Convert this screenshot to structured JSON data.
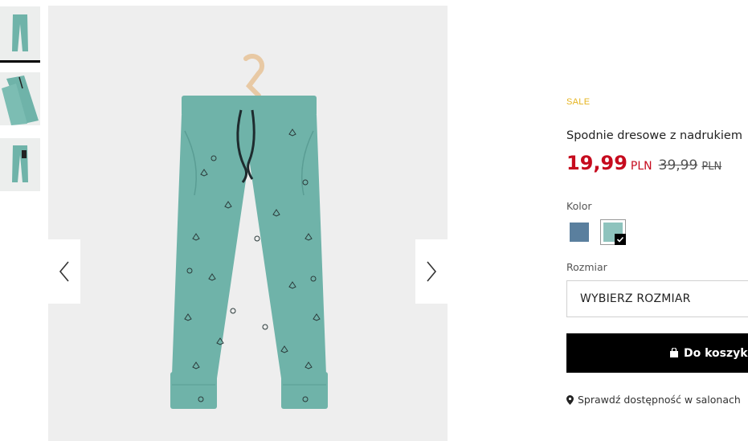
{
  "gallery": {
    "thumbnails": [
      "front",
      "detail",
      "back"
    ],
    "active_index": 0
  },
  "product": {
    "badge": "SALE",
    "title": "Spodnie dresowe z nadrukiem",
    "price_new": "19,99",
    "price_new_currency": "PLN",
    "price_old": "39,99",
    "price_old_currency": "PLN"
  },
  "color": {
    "label": "Kolor",
    "options": [
      {
        "name": "blue-print",
        "hex": "#5a7f9e",
        "selected": false
      },
      {
        "name": "mint-print",
        "hex": "#8ec3bd",
        "selected": true
      }
    ]
  },
  "size": {
    "label": "Rozmiar",
    "select_value": "WYBIERZ ROZMIAR"
  },
  "actions": {
    "add_to_cart": "Do koszyka",
    "store_availability": "Sprawdź dostępność w salonach"
  },
  "colors": {
    "sale": "#e6b41f",
    "price": "#c60b1e",
    "product_mint": "#6fb3a9"
  }
}
